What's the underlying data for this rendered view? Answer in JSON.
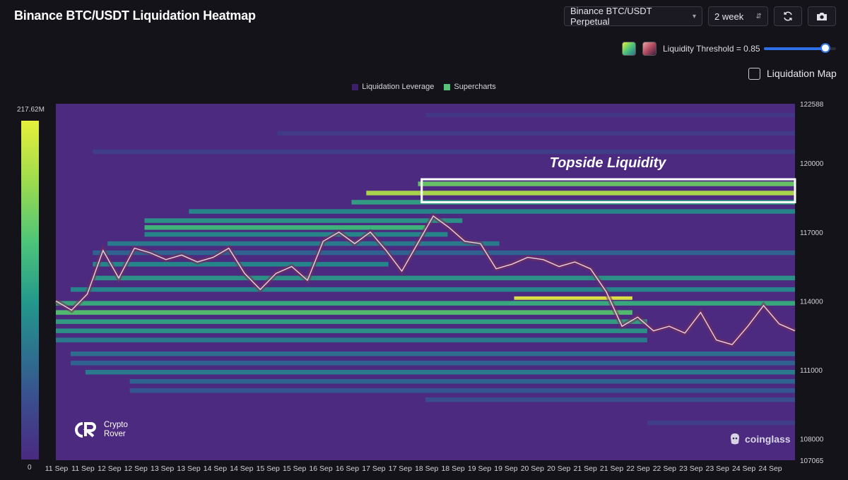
{
  "header": {
    "title": "Binance BTC/USDT Liquidation Heatmap",
    "pair_select": "Binance BTC/USDT Perpetual",
    "range_select": "2 week",
    "refresh_icon": "refresh-icon",
    "screenshot_icon": "camera-icon"
  },
  "controls": {
    "threshold_label": "Liquidity Threshold = 0.85",
    "threshold_value": 0.85,
    "liquidation_map_label": "Liquidation Map",
    "liquidation_map_checked": false,
    "palette_colors": [
      "#56c27a",
      "#b04a5e"
    ]
  },
  "colorbar": {
    "max_label": "217.62M",
    "min_label": "0"
  },
  "branding": {
    "left_line1": "Crypto",
    "left_line2": "Rover",
    "right": "coinglass"
  },
  "chart_data": {
    "type": "heatmap",
    "legend": [
      {
        "name": "Liquidation Leverage",
        "color": "#3d1e6d"
      },
      {
        "name": "Supercharts",
        "color": "#56c27a"
      }
    ],
    "annotation": "Topside Liquidity",
    "y_ticks": [
      122588,
      120000,
      117000,
      114000,
      111000,
      108000,
      107065
    ],
    "ylim": [
      107065,
      122588
    ],
    "x_ticks": [
      "11 Sep",
      "11 Sep",
      "12 Sep",
      "12 Sep",
      "13 Sep",
      "13 Sep",
      "14 Sep",
      "14 Sep",
      "15 Sep",
      "15 Sep",
      "16 Sep",
      "16 Sep",
      "17 Sep",
      "17 Sep",
      "18 Sep",
      "18 Sep",
      "19 Sep",
      "19 Sep",
      "20 Sep",
      "20 Sep",
      "21 Sep",
      "21 Sep",
      "22 Sep",
      "22 Sep",
      "23 Sep",
      "23 Sep",
      "24 Sep",
      "24 Sep"
    ],
    "price_path": [
      [
        0,
        114000
      ],
      [
        1,
        113600
      ],
      [
        2,
        114300
      ],
      [
        3,
        116200
      ],
      [
        4,
        115000
      ],
      [
        5,
        116300
      ],
      [
        6,
        116100
      ],
      [
        7,
        115800
      ],
      [
        8,
        116000
      ],
      [
        9,
        115700
      ],
      [
        10,
        115900
      ],
      [
        11,
        116300
      ],
      [
        12,
        115200
      ],
      [
        13,
        114500
      ],
      [
        14,
        115200
      ],
      [
        15,
        115500
      ],
      [
        16,
        114900
      ],
      [
        17,
        116600
      ],
      [
        18,
        117000
      ],
      [
        19,
        116500
      ],
      [
        20,
        117000
      ],
      [
        21,
        116200
      ],
      [
        22,
        115300
      ],
      [
        23,
        116500
      ],
      [
        24,
        117700
      ],
      [
        25,
        117200
      ],
      [
        26,
        116600
      ],
      [
        27,
        116500
      ],
      [
        28,
        115400
      ],
      [
        29,
        115600
      ],
      [
        30,
        115900
      ],
      [
        31,
        115800
      ],
      [
        32,
        115500
      ],
      [
        33,
        115700
      ],
      [
        34,
        115400
      ],
      [
        35,
        114400
      ],
      [
        36,
        112900
      ],
      [
        37,
        113300
      ],
      [
        38,
        112700
      ],
      [
        39,
        112900
      ],
      [
        40,
        112600
      ],
      [
        41,
        113500
      ],
      [
        42,
        112300
      ],
      [
        43,
        112100
      ],
      [
        44,
        112900
      ],
      [
        45,
        113800
      ],
      [
        46,
        113000
      ],
      [
        47,
        112700
      ]
    ],
    "bands": [
      {
        "low": 119000,
        "high": 119200,
        "start": 0.49,
        "end": 1.0,
        "intensity": 0.75
      },
      {
        "low": 118600,
        "high": 118800,
        "start": 0.42,
        "end": 1.0,
        "intensity": 0.9
      },
      {
        "low": 118200,
        "high": 118400,
        "start": 0.4,
        "end": 1.0,
        "intensity": 0.55
      },
      {
        "low": 117800,
        "high": 118000,
        "start": 0.18,
        "end": 1.0,
        "intensity": 0.45
      },
      {
        "low": 117400,
        "high": 117600,
        "start": 0.12,
        "end": 0.55,
        "intensity": 0.5
      },
      {
        "low": 117100,
        "high": 117300,
        "start": 0.12,
        "end": 0.5,
        "intensity": 0.65
      },
      {
        "low": 116800,
        "high": 117000,
        "start": 0.12,
        "end": 0.53,
        "intensity": 0.45
      },
      {
        "low": 116400,
        "high": 116600,
        "start": 0.07,
        "end": 0.6,
        "intensity": 0.4
      },
      {
        "low": 116000,
        "high": 116200,
        "start": 0.05,
        "end": 1.0,
        "intensity": 0.3
      },
      {
        "low": 115500,
        "high": 115700,
        "start": 0.05,
        "end": 0.45,
        "intensity": 0.45
      },
      {
        "low": 114900,
        "high": 115100,
        "start": 0.05,
        "end": 1.0,
        "intensity": 0.5
      },
      {
        "low": 114400,
        "high": 114600,
        "start": 0.02,
        "end": 1.0,
        "intensity": 0.45
      },
      {
        "low": 114050,
        "high": 114200,
        "start": 0.62,
        "end": 0.78,
        "intensity": 1.0
      },
      {
        "low": 113800,
        "high": 114000,
        "start": 0.0,
        "end": 1.0,
        "intensity": 0.6
      },
      {
        "low": 113400,
        "high": 113600,
        "start": 0.0,
        "end": 0.78,
        "intensity": 0.7
      },
      {
        "low": 113000,
        "high": 113200,
        "start": 0.0,
        "end": 0.8,
        "intensity": 0.55
      },
      {
        "low": 112600,
        "high": 112800,
        "start": 0.0,
        "end": 0.8,
        "intensity": 0.5
      },
      {
        "low": 112200,
        "high": 112400,
        "start": 0.0,
        "end": 0.8,
        "intensity": 0.4
      },
      {
        "low": 111600,
        "high": 111800,
        "start": 0.02,
        "end": 1.0,
        "intensity": 0.35
      },
      {
        "low": 111200,
        "high": 111400,
        "start": 0.02,
        "end": 1.0,
        "intensity": 0.3
      },
      {
        "low": 110800,
        "high": 111000,
        "start": 0.04,
        "end": 1.0,
        "intensity": 0.4
      },
      {
        "low": 110400,
        "high": 110600,
        "start": 0.1,
        "end": 1.0,
        "intensity": 0.3
      },
      {
        "low": 110000,
        "high": 110200,
        "start": 0.1,
        "end": 1.0,
        "intensity": 0.25
      },
      {
        "low": 109600,
        "high": 109800,
        "start": 0.5,
        "end": 1.0,
        "intensity": 0.2
      },
      {
        "low": 108600,
        "high": 108800,
        "start": 0.8,
        "end": 1.0,
        "intensity": 0.12
      },
      {
        "low": 120400,
        "high": 120600,
        "start": 0.05,
        "end": 1.0,
        "intensity": 0.12
      },
      {
        "low": 121200,
        "high": 121400,
        "start": 0.3,
        "end": 1.0,
        "intensity": 0.1
      },
      {
        "low": 122000,
        "high": 122200,
        "start": 0.5,
        "end": 1.0,
        "intensity": 0.08
      }
    ],
    "highlight_box": {
      "low": 118300,
      "high": 119300,
      "start": 0.495,
      "end": 1.0
    }
  }
}
